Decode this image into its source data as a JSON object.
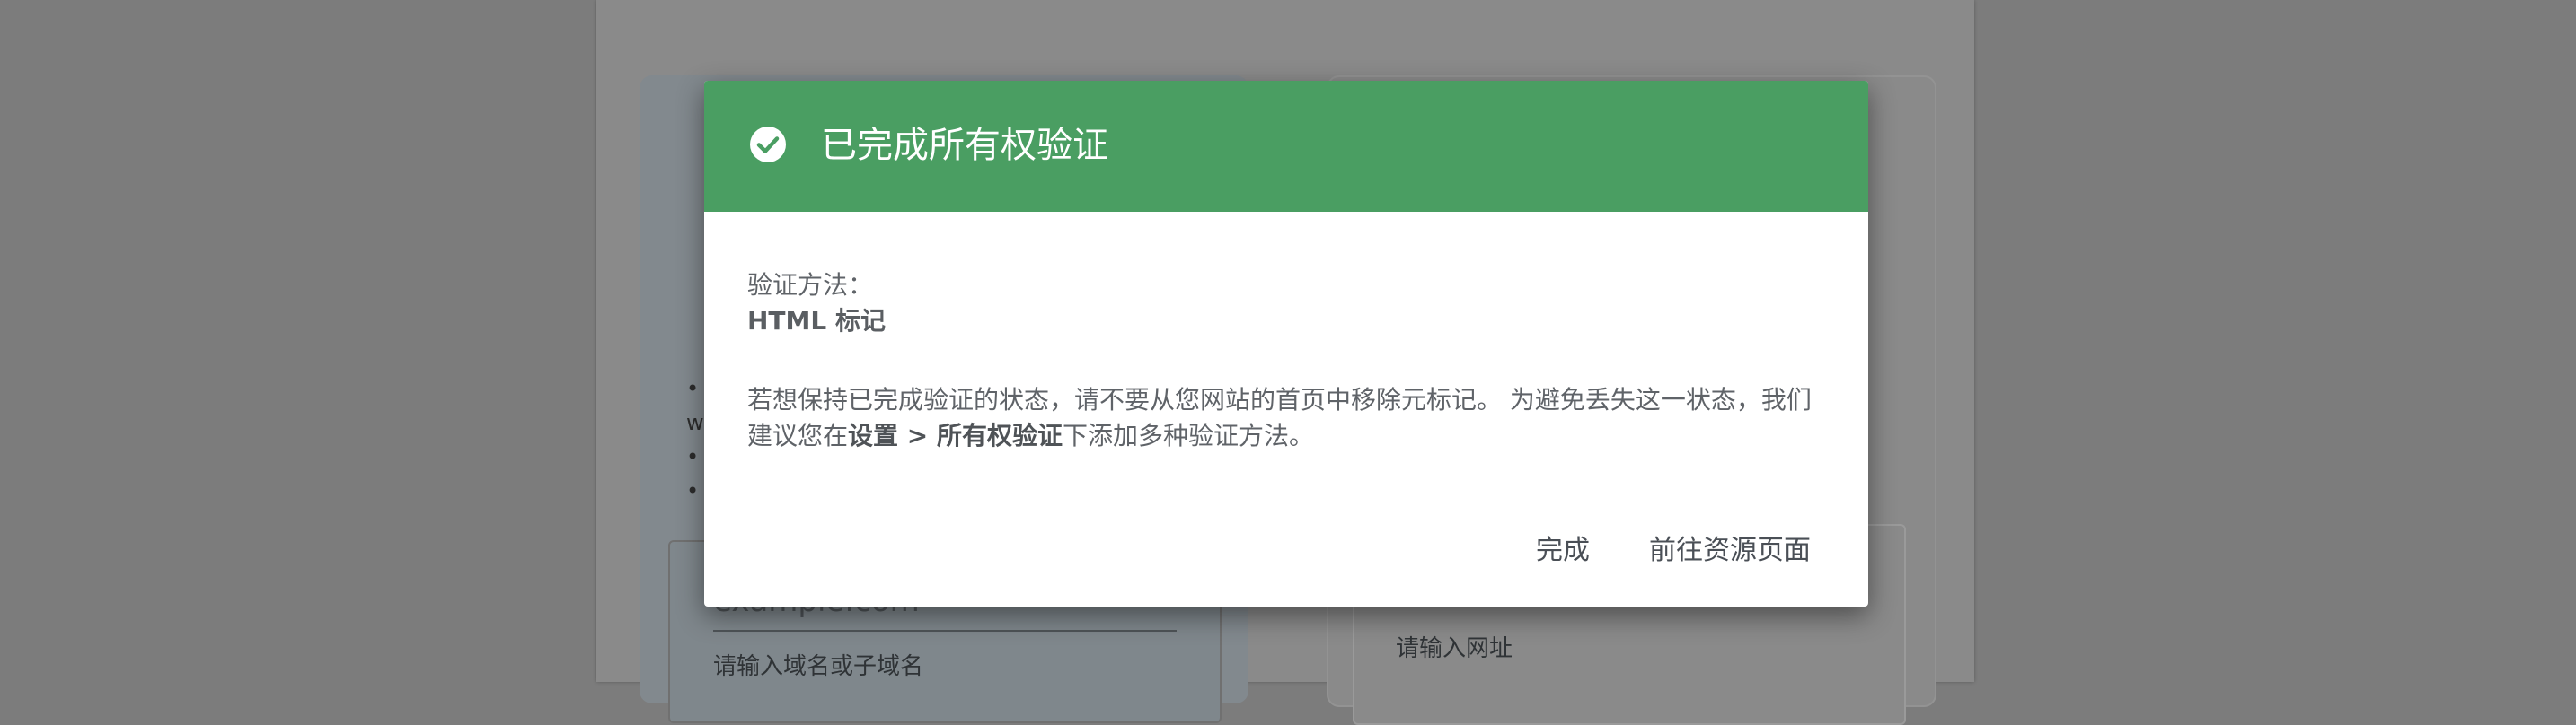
{
  "background": {
    "bullet_fragment": "w",
    "left_input": {
      "value": "example.com",
      "hint": "请输入域名或子域名"
    },
    "right_input": {
      "hint": "请输入网址"
    }
  },
  "dialog": {
    "title": "已完成所有权验证",
    "method_label": "验证方法：",
    "method_value": "HTML 标记",
    "desc_part1": "若想保持已完成验证的状态，请不要从您网站的首页中移除元标记。 为避免丢失这一状态，我们建议您在",
    "desc_bold": "设置 > 所有权验证",
    "desc_part2": "下添加多种验证方法。",
    "done_button": "完成",
    "go_button": "前往资源页面"
  },
  "colors": {
    "header": "#4a9e62",
    "overlay": "#7c7c7c"
  },
  "icons": {
    "header": "check-circle-icon"
  }
}
